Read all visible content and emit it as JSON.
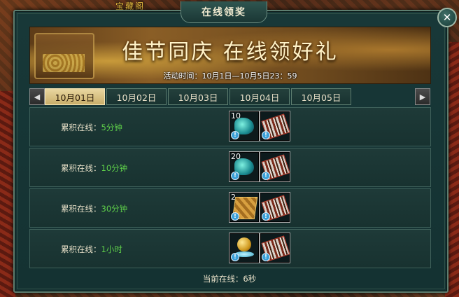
{
  "background": {
    "sign_text": "宝藏阁"
  },
  "window": {
    "title": "在线领奖",
    "close_glyph": "✕"
  },
  "banner": {
    "title": "佳节同庆 在线领好礼",
    "time_text": "活动时间：10月1日—10月5日23：59"
  },
  "tabs": {
    "left_arrow": "◀",
    "right_arrow": "▶",
    "items": [
      {
        "label": "10月01日",
        "active": true
      },
      {
        "label": "10月02日",
        "active": false
      },
      {
        "label": "10月03日",
        "active": false
      },
      {
        "label": "10月04日",
        "active": false
      },
      {
        "label": "10月05日",
        "active": false
      }
    ]
  },
  "rewards": [
    {
      "label": "累积在线：",
      "value": "5分钟",
      "items": [
        {
          "icon": "gem-icon",
          "count": "10"
        },
        {
          "icon": "abacus-icon",
          "count": ""
        }
      ]
    },
    {
      "label": "累积在线：",
      "value": "10分钟",
      "items": [
        {
          "icon": "gem-icon",
          "count": "20"
        },
        {
          "icon": "abacus-icon",
          "count": ""
        }
      ]
    },
    {
      "label": "累积在线：",
      "value": "30分钟",
      "items": [
        {
          "icon": "book-icon",
          "count": "2"
        },
        {
          "icon": "abacus-icon",
          "count": ""
        }
      ]
    },
    {
      "label": "累积在线：",
      "value": "1小时",
      "items": [
        {
          "icon": "orb-icon",
          "count": ""
        },
        {
          "icon": "abacus-icon",
          "count": ""
        }
      ]
    }
  ],
  "item_info_glyph": "!",
  "footer": {
    "online_text": "当前在线：6秒"
  },
  "colors": {
    "accent_green": "#5fd14a",
    "active_tab": "#e9d7a0",
    "panel": "#183838"
  }
}
